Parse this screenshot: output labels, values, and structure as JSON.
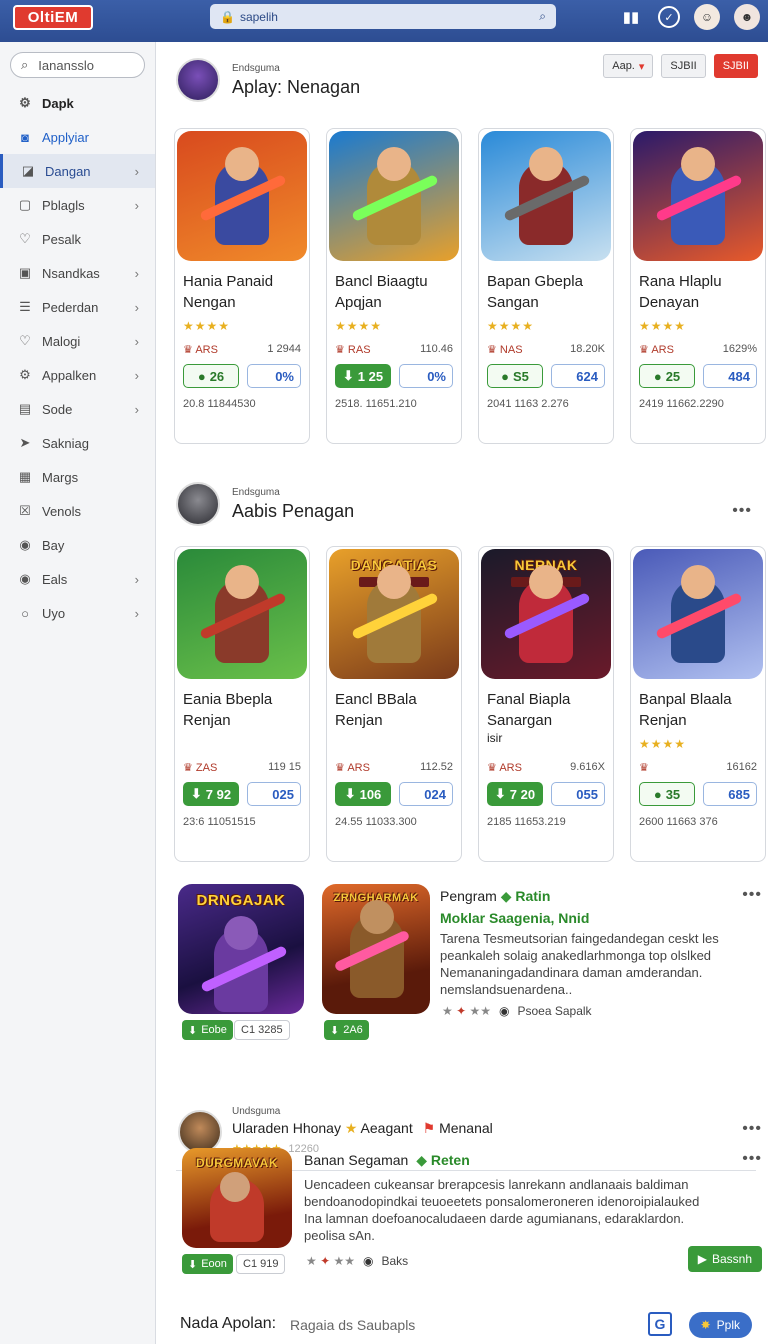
{
  "topbar": {
    "logo": "OltiEM",
    "search_value": "sapelih"
  },
  "sidebar": {
    "search_value": "Ianansslo",
    "items": [
      {
        "label": "Dapk",
        "icon": "gear-icon"
      },
      {
        "label": "Applyiar",
        "icon": "camera-icon"
      },
      {
        "label": "Dangan",
        "icon": "chart-icon"
      },
      {
        "label": "Pblagls",
        "icon": "square-icon"
      },
      {
        "label": "Pesalk",
        "icon": "heart-icon"
      },
      {
        "label": "Nsandkas",
        "icon": "square-dot-icon"
      },
      {
        "label": "Pederdan",
        "icon": "list-icon"
      },
      {
        "label": "Malogi",
        "icon": "heart-icon"
      },
      {
        "label": "Appalken",
        "icon": "gear-icon"
      },
      {
        "label": "Sode",
        "icon": "box-icon"
      },
      {
        "label": "Sakniag",
        "icon": "send-icon"
      },
      {
        "label": "Margs",
        "icon": "document-icon"
      },
      {
        "label": "Venols",
        "icon": "x-square-icon"
      },
      {
        "label": "Bay",
        "icon": "circle-dot-icon"
      },
      {
        "label": "Eals",
        "icon": "circle-dot-icon"
      },
      {
        "label": "Uyo",
        "icon": "circle-icon"
      }
    ]
  },
  "section1": {
    "small": "Endsguma",
    "title": "Aplay: Nenagan",
    "filters": [
      "Aap.",
      "SJBII",
      "SJBII"
    ],
    "cards": [
      {
        "name1": "Hania Panaid",
        "name2": "Nengan",
        "rating": "★★★★",
        "pub": "ARS",
        "count": "1 2944",
        "price": "26",
        "pct": "0%",
        "foot": "20.8 11844530"
      },
      {
        "name1": "Bancl Biaagtu",
        "name2": "Apqjan",
        "rating": "★★★★",
        "pub": "RAS",
        "count": "110.46",
        "price": "1 25",
        "pct": "0%",
        "foot": "2518. 11651.210"
      },
      {
        "name1": "Bapan Gbepla",
        "name2": "Sangan",
        "rating": "★★★★",
        "pub": "NAS",
        "count": "18.20K",
        "price": "S5",
        "pct": "624",
        "foot": "2041 1163 2.276"
      },
      {
        "name1": "Rana Hlaplu",
        "name2": "Denayan",
        "rating": "★★★★",
        "pub": "ARS",
        "count": "1629%",
        "price": "25",
        "pct": "484",
        "foot": "2419 11662.2290"
      }
    ]
  },
  "section2": {
    "small": "Endsguma",
    "title": "Aabis Penagan",
    "cards": [
      {
        "name1": "Eania Bbepla",
        "name2": "Renjan",
        "name3": "",
        "rating": "",
        "pub": "ZAS",
        "count": "119 15",
        "price": "7 92",
        "pct": "025",
        "foot": "23:6 11051515",
        "title_art": ""
      },
      {
        "name1": "Eancl BBala",
        "name2": "Renjan",
        "name3": "",
        "rating": "",
        "pub": "ARS",
        "count": "112.52",
        "price": "106",
        "pct": "024",
        "foot": "24.55 11033.300",
        "title_art": "DANGATIAS"
      },
      {
        "name1": "Fanal Biapla",
        "name2": "Sanargan",
        "name3": "isir",
        "rating": "",
        "pub": "ARS",
        "count": "9.616X",
        "price": "7 20",
        "pct": "055",
        "foot": "2185 11653.219",
        "title_art": "NERNAK"
      },
      {
        "name1": "Banpal Blaala",
        "name2": "Renjan",
        "name3": "",
        "rating": "★★★★",
        "pub": "",
        "count": "16162",
        "price": "35",
        "pct": "685",
        "foot": "2600 11663 376",
        "title_art": ""
      }
    ]
  },
  "list1": {
    "thumb1_title": "DRNGAJAK",
    "thumb2_title": "ZRNGHARMAK",
    "pill1": "Eobe",
    "pill2": "C1 3285",
    "pill3": "2A6",
    "title": "Pengram",
    "tag": "Ratin",
    "sub": "Moklar Saagenia, Nnid",
    "desc": "Tarena Tesmeutsorian faingedandegan ceskt les peankaleh solaig anakedlarhmonga top olslked Nemananingadandinara daman amderandan. nemslandsuenardena..",
    "publisher": "Psoea Sapalk"
  },
  "list2": {
    "small": "Undsguma",
    "title": "Ularaden Hhonay",
    "title2": "Aeagant",
    "title3": "Menanal",
    "rating": "★★★★★",
    "count": "12260"
  },
  "list3": {
    "thumb_title": "DURGMAVAK",
    "title": "Banan Segaman",
    "tag": "Reten",
    "desc": "Uencadeen cukeansar brerapcesis lanrekann andlanaais baldiman bendoanodopindkai teuoeetets ponsalomeroneren idenoroipialauked Ina lamnan doefoanocaludaeen darde agumianans, edaraklardon. peolisa sAn.",
    "pill1": "Eoon",
    "pill2": "C1 919",
    "publisher": "Baks",
    "get": "Bassnh"
  },
  "footer": {
    "title": "Nada Apolan:",
    "sub": "Ragaia ds Saubapls",
    "button": "Pplk"
  }
}
